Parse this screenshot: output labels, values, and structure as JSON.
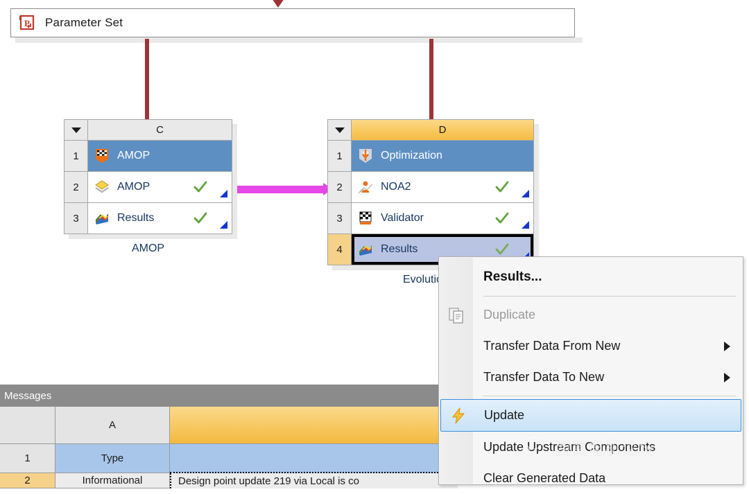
{
  "parameter_set": {
    "label": "Parameter Set",
    "icon": "parameter-set-icon"
  },
  "blocks": [
    {
      "id": "C",
      "column_letter": "C",
      "caption": "AMOP",
      "header_style": "grey",
      "rows": [
        {
          "num": "1",
          "label": "AMOP",
          "icon": "validator-flag-icon",
          "state": "selected-blue",
          "check": false,
          "corner": false
        },
        {
          "num": "2",
          "label": "AMOP",
          "icon": "amop-sheet-icon",
          "state": "normal",
          "check": true,
          "corner": true
        },
        {
          "num": "3",
          "label": "Results",
          "icon": "results-surface-icon",
          "state": "normal",
          "check": true,
          "corner": true
        }
      ]
    },
    {
      "id": "D",
      "column_letter": "D",
      "caption": "Evolutionar",
      "header_style": "amber",
      "rows": [
        {
          "num": "1",
          "label": "Optimization",
          "icon": "optimization-icon",
          "state": "selected-blue",
          "check": false,
          "corner": false
        },
        {
          "num": "2",
          "label": "NOA2",
          "icon": "noa2-person-icon",
          "state": "normal",
          "check": true,
          "corner": true
        },
        {
          "num": "3",
          "label": "Validator",
          "icon": "validator-flag-icon",
          "state": "normal",
          "check": true,
          "corner": true
        },
        {
          "num": "4",
          "label": "Results",
          "icon": "results-surface-icon",
          "state": "selected-lavender",
          "check": true,
          "corner": true
        }
      ]
    }
  ],
  "context_menu": {
    "header": "Results...",
    "items": [
      {
        "label": "Duplicate",
        "icon": "duplicate-icon",
        "disabled": true,
        "submenu": false,
        "highlighted": false
      },
      {
        "label": "Transfer Data From New",
        "icon": null,
        "disabled": false,
        "submenu": true,
        "highlighted": false
      },
      {
        "label": "Transfer Data To New",
        "icon": null,
        "disabled": false,
        "submenu": true,
        "highlighted": false
      },
      {
        "label": "Update",
        "icon": "lightning-icon",
        "disabled": false,
        "submenu": false,
        "highlighted": true
      },
      {
        "label": "Update Upstream Components",
        "icon": null,
        "disabled": false,
        "submenu": false,
        "highlighted": false
      },
      {
        "label": "Clear Generated Data",
        "icon": null,
        "disabled": false,
        "submenu": false,
        "highlighted": false
      }
    ]
  },
  "messages": {
    "title": "Messages",
    "columns": [
      "",
      "A",
      ""
    ],
    "rows": [
      {
        "num": "1",
        "a": "Type",
        "b": ""
      },
      {
        "num": "2",
        "a": "Informational",
        "b": "Design point update 219 via Local is co"
      }
    ]
  },
  "watermark": {
    "text": "西莫电机论坛",
    "icon": "wechat-icon"
  },
  "colors": {
    "connector_red": "#9c3436",
    "connector_magenta": "#e547e8",
    "selection_blue": "#5d8fc2",
    "selection_lavender": "#b9c4e3",
    "amber_header": "#f5bc44",
    "message_blue": "#a8c6ea",
    "titlebar_grey": "#8b8b8b"
  }
}
